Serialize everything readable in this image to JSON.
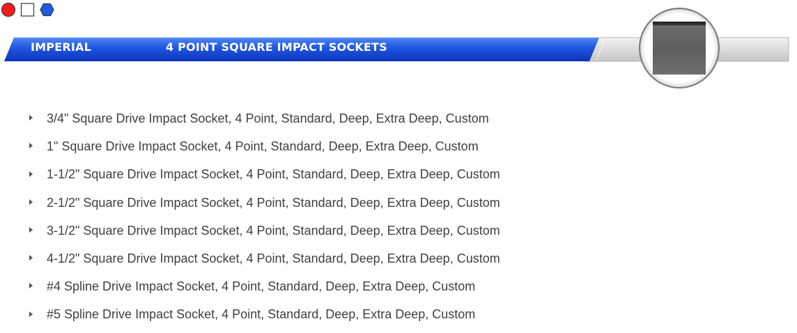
{
  "header": {
    "category": "IMPERIAL",
    "title": "4 POINT SQUARE IMPACT SOCKETS",
    "accent_color": "#1746d6",
    "shape_icons": [
      "red-circle-icon",
      "white-square-icon",
      "blue-hexagon-icon"
    ]
  },
  "products": [
    {
      "label": "3/4\" Square Drive Impact Socket, 4 Point, Standard, Deep, Extra Deep, Custom"
    },
    {
      "label": "1\" Square Drive Impact Socket, 4 Point, Standard, Deep, Extra Deep, Custom"
    },
    {
      "label": "1-1/2\" Square Drive Impact Socket, 4 Point, Standard, Deep, Extra Deep, Custom"
    },
    {
      "label": "2-1/2\" Square Drive Impact Socket, 4 Point, Standard, Deep, Extra Deep, Custom"
    },
    {
      "label": "3-1/2\" Square Drive Impact Socket, 4 Point, Standard, Deep, Extra Deep, Custom"
    },
    {
      "label": "4-1/2\" Square Drive Impact Socket, 4 Point, Standard, Deep, Extra Deep, Custom"
    },
    {
      "label": "#4 Spline Drive Impact Socket, 4 Point, Standard, Deep, Extra Deep, Custom"
    },
    {
      "label": "#5 Spline Drive Impact Socket, 4 Point, Standard, Deep, Extra Deep, Custom"
    }
  ]
}
